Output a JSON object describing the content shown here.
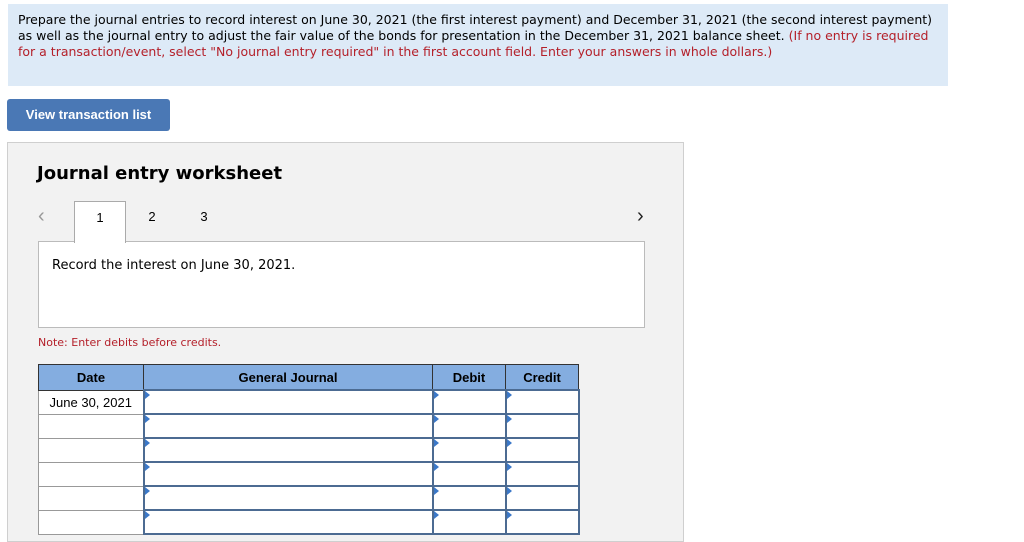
{
  "instructions": {
    "main_text": "Prepare the journal entries to record interest on June 30, 2021 (the first interest payment) and December 31, 2021 (the second interest payment) as well as the journal entry to adjust the fair value of the bonds for presentation in the December 31, 2021 balance sheet.",
    "red_text": "(If no entry is required for a transaction/event, select \"No journal entry required\" in the first account field. Enter your answers in whole dollars.)"
  },
  "buttons": {
    "view_transaction_list": "View transaction list"
  },
  "worksheet": {
    "title": "Journal entry worksheet",
    "prev_icon": "‹",
    "next_icon": "›",
    "tabs": [
      {
        "label": "1",
        "active": true
      },
      {
        "label": "2",
        "active": false
      },
      {
        "label": "3",
        "active": false
      }
    ],
    "description": "Record the interest on June 30, 2021.",
    "note": "Note: Enter debits before credits.",
    "table": {
      "headers": [
        "Date",
        "General Journal",
        "Debit",
        "Credit"
      ],
      "rows": [
        {
          "date": "June 30, 2021",
          "account": "",
          "debit": "",
          "credit": ""
        },
        {
          "date": "",
          "account": "",
          "debit": "",
          "credit": ""
        },
        {
          "date": "",
          "account": "",
          "debit": "",
          "credit": ""
        },
        {
          "date": "",
          "account": "",
          "debit": "",
          "credit": ""
        },
        {
          "date": "",
          "account": "",
          "debit": "",
          "credit": ""
        },
        {
          "date": "",
          "account": "",
          "debit": "",
          "credit": ""
        }
      ]
    }
  },
  "colors": {
    "accent": "#4a78b5",
    "header_bg": "#84ade0",
    "instruction_bg": "#ddeaf7",
    "note_red": "#b4202a"
  }
}
